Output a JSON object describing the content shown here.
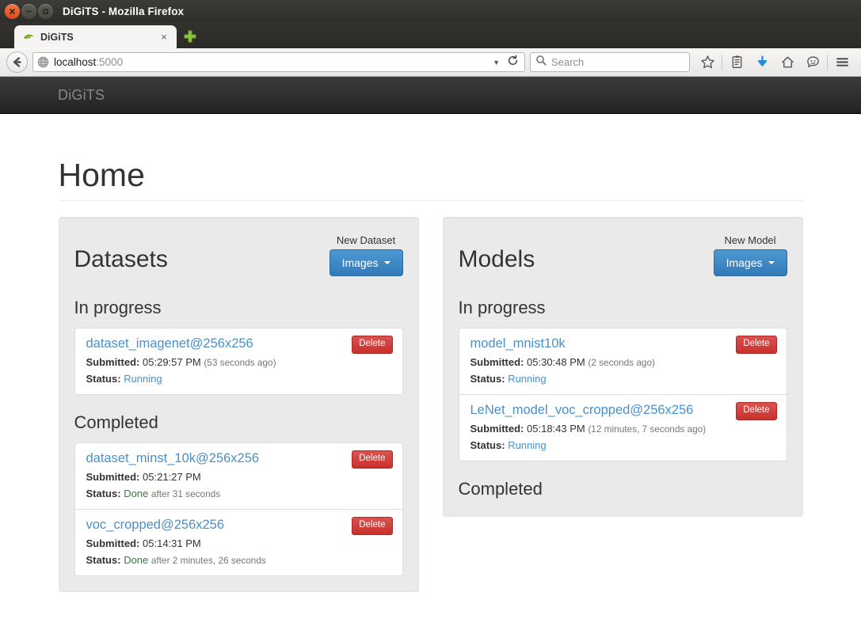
{
  "window": {
    "title": "DiGiTS - Mozilla Firefox",
    "controls": [
      "close",
      "minimize",
      "maximize"
    ]
  },
  "browser": {
    "tab": {
      "label": "DiGiTS",
      "favicon": "nvidia-eye-icon",
      "close": "×"
    },
    "new_tab": "+",
    "back_icon": "back-arrow-icon",
    "url": {
      "host": "localhost",
      "port": ":5000",
      "favicon": "globe-icon"
    },
    "url_dropdown_icon": "chevron-down-icon",
    "reload_icon": "reload-icon",
    "search": {
      "placeholder": "Search",
      "icon": "search-icon"
    },
    "toolbar_icons": [
      "bookmark-star-icon",
      "library-icon",
      "downloads-icon",
      "home-icon",
      "sync-chat-icon",
      "menu-hamburger-icon"
    ]
  },
  "app": {
    "brand": "DiGiTS",
    "page_title": "Home"
  },
  "datasets": {
    "title": "Datasets",
    "new_label": "New Dataset",
    "new_button": "Images",
    "sections": [
      {
        "heading": "In progress",
        "items": [
          {
            "name": "dataset_imagenet@256x256",
            "submitted_label": "Submitted:",
            "submitted_time": "05:29:57 PM",
            "submitted_ago": "(53 seconds ago)",
            "status_label": "Status:",
            "status": "Running",
            "status_kind": "running",
            "status_extra": "",
            "delete": "Delete"
          }
        ]
      },
      {
        "heading": "Completed",
        "items": [
          {
            "name": "dataset_minst_10k@256x256",
            "submitted_label": "Submitted:",
            "submitted_time": "05:21:27 PM",
            "submitted_ago": "",
            "status_label": "Status:",
            "status": "Done",
            "status_kind": "done",
            "status_extra": "after 31 seconds",
            "delete": "Delete"
          },
          {
            "name": "voc_cropped@256x256",
            "submitted_label": "Submitted:",
            "submitted_time": "05:14:31 PM",
            "submitted_ago": "",
            "status_label": "Status:",
            "status": "Done",
            "status_kind": "done",
            "status_extra": "after 2 minutes, 26 seconds",
            "delete": "Delete"
          }
        ]
      }
    ]
  },
  "models": {
    "title": "Models",
    "new_label": "New Model",
    "new_button": "Images",
    "sections": [
      {
        "heading": "In progress",
        "items": [
          {
            "name": "model_mnist10k",
            "submitted_label": "Submitted:",
            "submitted_time": "05:30:48 PM",
            "submitted_ago": "(2 seconds ago)",
            "status_label": "Status:",
            "status": "Running",
            "status_kind": "running",
            "status_extra": "",
            "delete": "Delete"
          },
          {
            "name": "LeNet_model_voc_cropped@256x256",
            "submitted_label": "Submitted:",
            "submitted_time": "05:18:43 PM",
            "submitted_ago": "(12 minutes, 7 seconds ago)",
            "status_label": "Status:",
            "status": "Running",
            "status_kind": "running",
            "status_extra": "",
            "delete": "Delete"
          }
        ]
      },
      {
        "heading": "Completed",
        "items": []
      }
    ]
  },
  "colors": {
    "primary_button": "#3c8dc5",
    "danger_button": "#d43f3a",
    "link": "#4a90c9",
    "status_done": "#3c763d",
    "panel_bg": "#eaeaea",
    "navbar_bg": "#222222"
  }
}
